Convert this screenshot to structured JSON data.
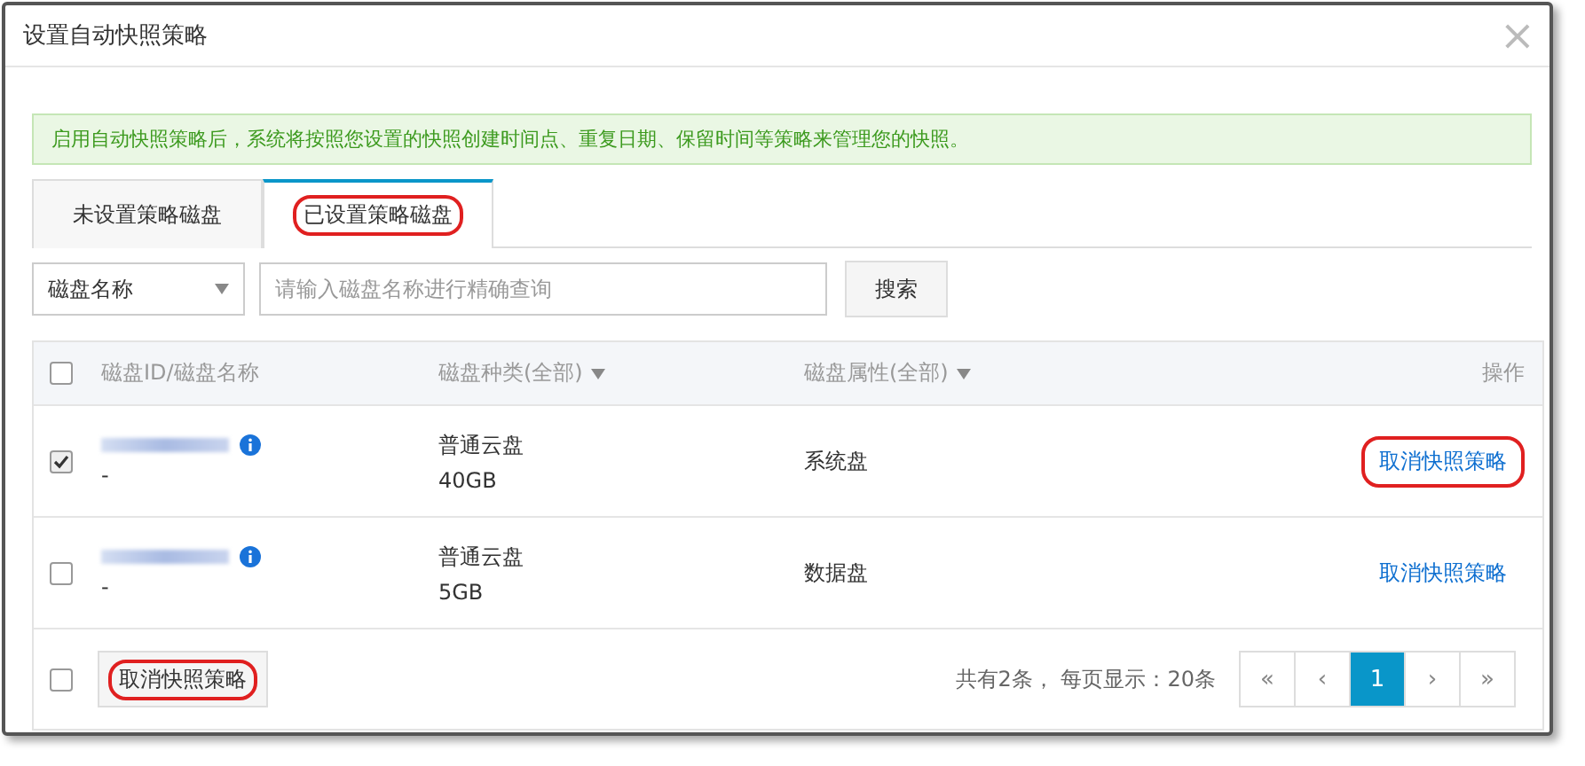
{
  "dialog": {
    "title": "设置自动快照策略",
    "close": "×"
  },
  "notice": "启用自动快照策略后，系统将按照您设置的快照创建时间点、重复日期、保留时间等策略来管理您的快照。",
  "tabs": [
    {
      "label": "未设置策略磁盘",
      "selected": false,
      "highlighted": false
    },
    {
      "label": "已设置策略磁盘",
      "selected": true,
      "highlighted": true
    }
  ],
  "search": {
    "filter": "磁盘名称",
    "placeholder": "请输入磁盘名称进行精确查询",
    "button": "搜索"
  },
  "table": {
    "checked": false,
    "columns": [
      "磁盘ID/磁盘名称",
      "磁盘种类(全部)",
      "磁盘属性(全部)",
      "操作"
    ],
    "rows": [
      {
        "checked": true,
        "name": "-",
        "type": "普通云盘",
        "size": "40GB",
        "attribute": "系统盘",
        "action": "取消快照策略",
        "highlighted": true
      },
      {
        "checked": false,
        "name": "-",
        "type": "普通云盘",
        "size": "5GB",
        "attribute": "数据盘",
        "action": "取消快照策略",
        "highlighted": false
      }
    ]
  },
  "footer": {
    "checked": false,
    "button": "取消快照策略",
    "button_highlighted": true,
    "summary": "共有2条， 每页显示：20条",
    "pages": [
      {
        "label": "«",
        "selected": false
      },
      {
        "label": "‹",
        "selected": false
      },
      {
        "label": "1",
        "selected": true
      },
      {
        "label": "›",
        "selected": false
      },
      {
        "label": "»",
        "selected": false
      }
    ]
  }
}
